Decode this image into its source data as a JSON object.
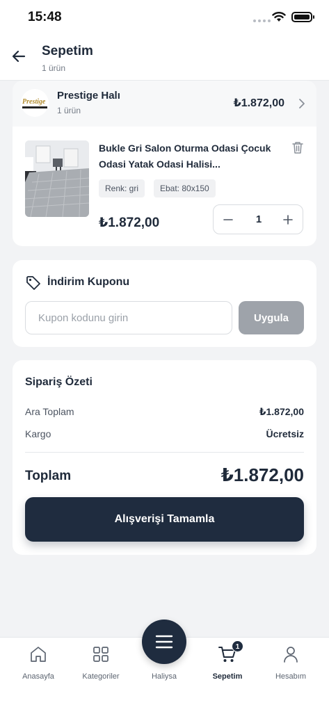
{
  "status_bar": {
    "time": "15:48"
  },
  "header": {
    "title": "Sepetim",
    "subtitle": "1 ürün",
    "back_icon": "arrow-left-icon"
  },
  "store": {
    "logo_text": "Prestige",
    "name": "Prestige Halı",
    "count": "1 ürün",
    "total": "₺1.872,00"
  },
  "product": {
    "name": "Bukle Gri Salon Oturma Odasi Çocuk Odasi Yatak Odasi Halisi...",
    "color_chip": "Renk: gri",
    "size_chip": "Ebat: 80x150",
    "price": "₺1.872,00",
    "quantity": "1"
  },
  "coupon": {
    "title": "İndirim Kuponu",
    "placeholder": "Kupon kodunu girin",
    "apply_label": "Uygula"
  },
  "summary": {
    "title": "Sipariş Özeti",
    "subtotal_label": "Ara Toplam",
    "subtotal_value": "₺1.872,00",
    "shipping_label": "Kargo",
    "shipping_value": "Ücretsiz",
    "total_label": "Toplam",
    "total_value": "₺1.872,00",
    "checkout_label": "Alışverişi Tamamla"
  },
  "tab_bar": {
    "items": [
      {
        "label": "Anasayfa",
        "icon": "home-icon"
      },
      {
        "label": "Kategoriler",
        "icon": "grid-icon"
      },
      {
        "label": "Haliysa",
        "icon": "menu-icon"
      },
      {
        "label": "Sepetim",
        "icon": "cart-icon",
        "badge": "1",
        "active": true
      },
      {
        "label": "Hesabım",
        "icon": "user-icon"
      }
    ]
  },
  "colors": {
    "primary": "#1f2c3f",
    "disabled_button": "#9ea3aa",
    "background": "#f2f3f5"
  }
}
